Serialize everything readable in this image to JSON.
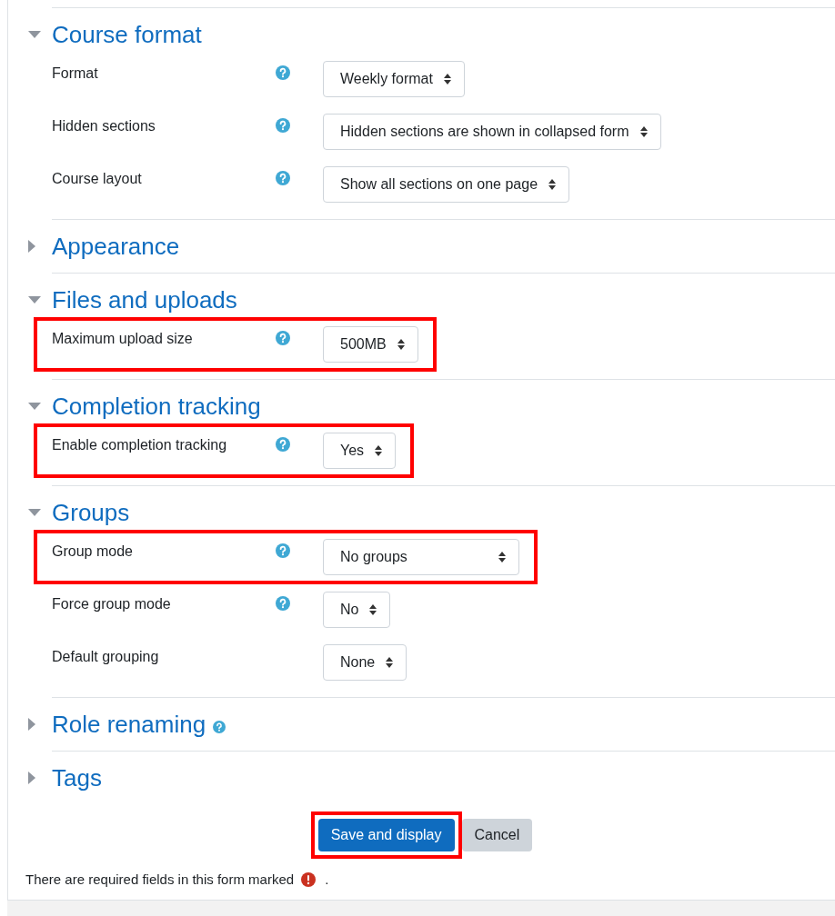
{
  "sections": [
    {
      "title": "Course format",
      "expanded": true,
      "help": false,
      "fields": [
        {
          "label": "Format",
          "help": true,
          "value": "Weekly format",
          "highlighted": false
        },
        {
          "label": "Hidden sections",
          "help": true,
          "value": "Hidden sections are shown in collapsed form",
          "highlighted": false
        },
        {
          "label": "Course layout",
          "help": true,
          "value": "Show all sections on one page",
          "highlighted": false
        }
      ]
    },
    {
      "title": "Appearance",
      "expanded": false,
      "help": false
    },
    {
      "title": "Files and uploads",
      "expanded": true,
      "help": false,
      "fields": [
        {
          "label": "Maximum upload size",
          "help": true,
          "value": "500MB",
          "highlighted": true
        }
      ]
    },
    {
      "title": "Completion tracking",
      "expanded": true,
      "help": false,
      "fields": [
        {
          "label": "Enable completion tracking",
          "help": true,
          "value": "Yes",
          "highlighted": true
        }
      ]
    },
    {
      "title": "Groups",
      "expanded": true,
      "help": false,
      "fields": [
        {
          "label": "Group mode",
          "help": true,
          "value": "No groups",
          "highlighted": true
        },
        {
          "label": "Force group mode",
          "help": true,
          "value": "No",
          "highlighted": false
        },
        {
          "label": "Default grouping",
          "help": false,
          "value": "None",
          "highlighted": false
        }
      ]
    },
    {
      "title": "Role renaming",
      "expanded": false,
      "help": true
    },
    {
      "title": "Tags",
      "expanded": false,
      "help": false
    }
  ],
  "buttons": [
    {
      "label": "Save and display",
      "kind": "primary",
      "highlighted": true
    },
    {
      "label": "Cancel",
      "kind": "secondary",
      "highlighted": false
    }
  ],
  "required_note": {
    "text": "There are required fields in this form marked",
    "end": "."
  }
}
